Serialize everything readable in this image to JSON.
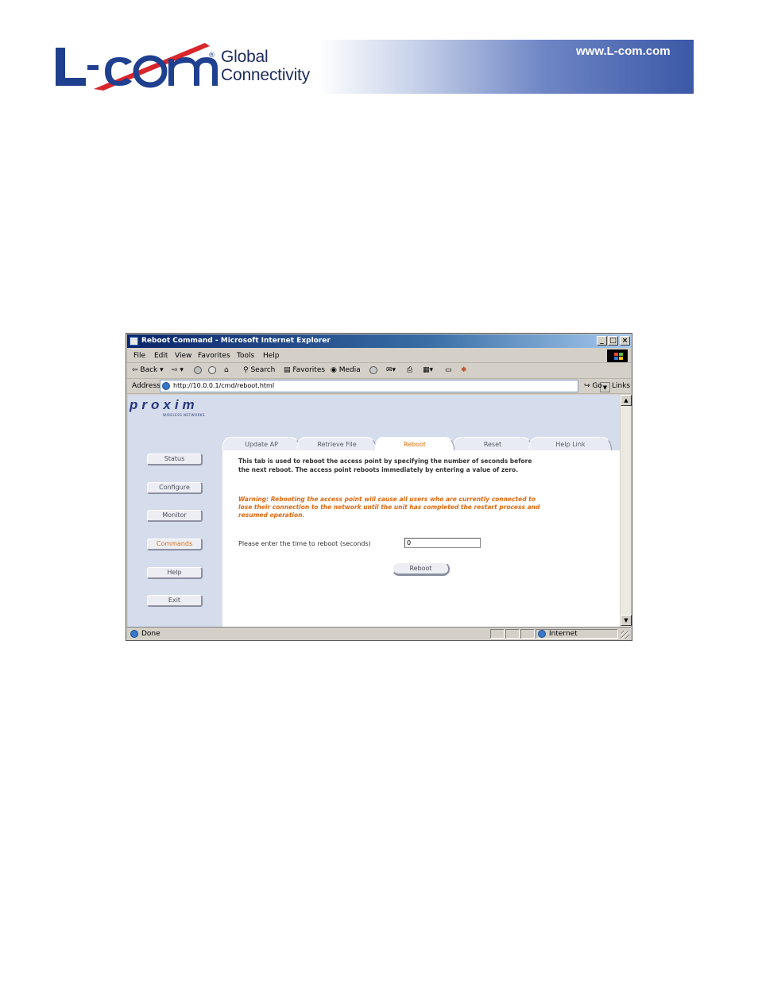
{
  "banner": {
    "logo_text": "L-com",
    "tagline_line1": "Global",
    "tagline_line2": "Connectivity",
    "url": "www.L-com.com"
  },
  "window": {
    "title": "Reboot Command - Microsoft Internet Explorer",
    "controls": {
      "minimize": "_",
      "maximize": "□",
      "close": "×"
    }
  },
  "menubar": [
    "File",
    "Edit",
    "View",
    "Favorites",
    "Tools",
    "Help"
  ],
  "toolbar": {
    "back": "Back",
    "search": "Search",
    "favorites": "Favorites",
    "media": "Media"
  },
  "addressbar": {
    "label": "Address",
    "url": "http://10.0.0.1/cmd/reboot.html",
    "go": "Go",
    "links": "Links"
  },
  "page": {
    "brand": "proxim",
    "brand_sub": "WIRELESS NETWORKS",
    "tabs": [
      "Update AP",
      "Retrieve File",
      "Reboot",
      "Reset",
      "Help Link"
    ],
    "active_tab": "Reboot",
    "nav": [
      "Status",
      "Configure",
      "Monitor",
      "Commands",
      "Help",
      "Exit"
    ],
    "active_nav": "Commands",
    "description": "This tab is used to reboot the access point by specifying the number of seconds before the next reboot. The access point reboots immediately by entering a value of zero.",
    "warning": "Warning: Rebooting the access point will cause all users who are currently connected to lose their connection to the network until the unit has completed the restart process and resumed operation.",
    "reboot_label": "Please enter the time to reboot (seconds)",
    "reboot_value": "0",
    "reboot_button": "Reboot"
  },
  "statusbar": {
    "status": "Done",
    "zone": "Internet"
  },
  "colors": {
    "accent": "#e07010",
    "page_bg": "#d5dceb",
    "brand_blue": "#27377c",
    "banner_blue": "#3b58a7"
  }
}
